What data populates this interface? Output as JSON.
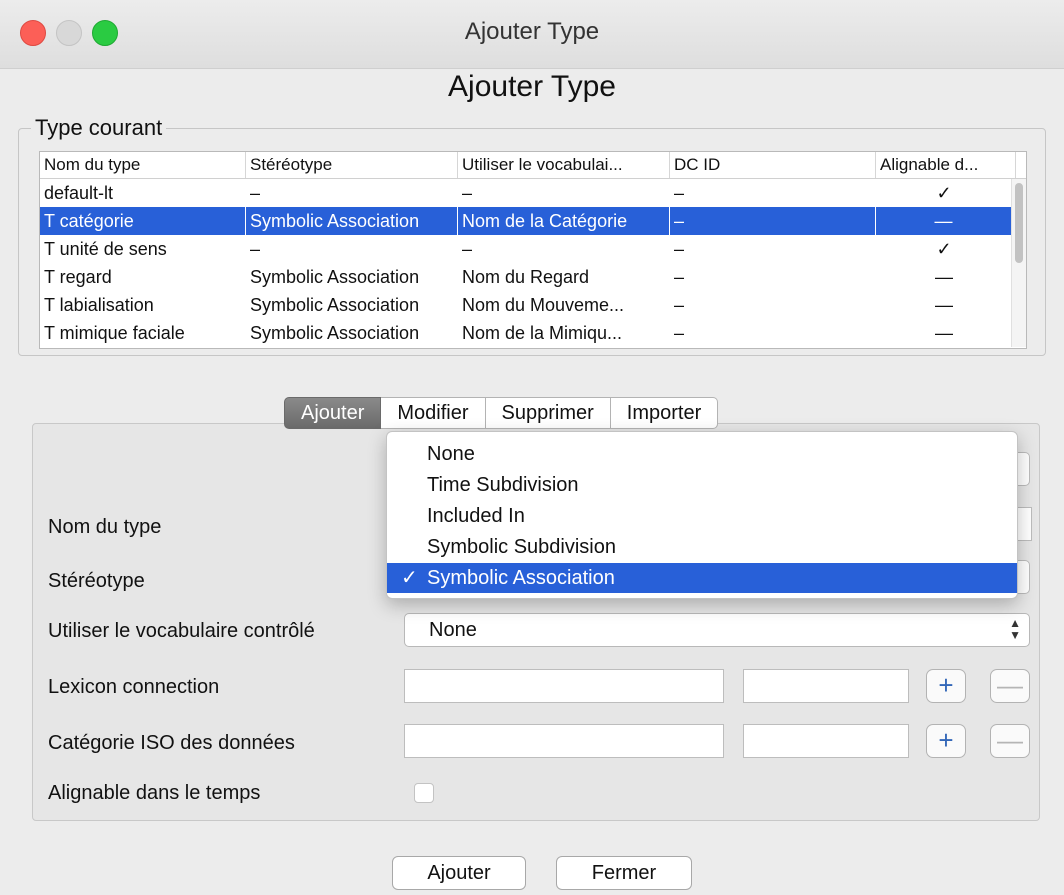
{
  "window": {
    "title": "Ajouter Type"
  },
  "dialog": {
    "heading": "Ajouter Type"
  },
  "current_types": {
    "legend": "Type courant",
    "columns": [
      "Nom du type",
      "Stéréotype",
      "Utiliser le vocabulai...",
      "DC ID",
      "Alignable d..."
    ],
    "rows": [
      {
        "name": "default-lt",
        "stereotype": "–",
        "vocab": "–",
        "dcid": "–",
        "alignable": "✓"
      },
      {
        "name": "T catégorie",
        "stereotype": "Symbolic Association",
        "vocab": "Nom de la Catégorie",
        "dcid": "–",
        "alignable": "—"
      },
      {
        "name": "T unité de sens",
        "stereotype": "–",
        "vocab": "–",
        "dcid": "–",
        "alignable": "✓"
      },
      {
        "name": "T regard",
        "stereotype": "Symbolic Association",
        "vocab": "Nom du Regard",
        "dcid": "–",
        "alignable": "—"
      },
      {
        "name": "T labialisation",
        "stereotype": "Symbolic Association",
        "vocab": "Nom du Mouveme...",
        "dcid": "–",
        "alignable": "—"
      },
      {
        "name": "T mimique faciale",
        "stereotype": "Symbolic Association",
        "vocab": "Nom de la Mimiqu...",
        "dcid": "–",
        "alignable": "—"
      }
    ],
    "selected_row": 1
  },
  "tabs": [
    "Ajouter",
    "Modifier",
    "Supprimer",
    "Importer"
  ],
  "active_tab": "Ajouter",
  "form": {
    "name_label": "Nom du type",
    "stereotype_label": "Stéréotype",
    "vocab_label": "Utiliser le vocabulaire contrôlé",
    "vocab_value": "None",
    "lexicon_label": "Lexicon connection",
    "iso_label": "Catégorie ISO des données",
    "alignable_label": "Alignable dans le temps",
    "alignable_checked": false,
    "plus_symbol": "+",
    "minus_symbol": "—"
  },
  "stereotype_dropdown": {
    "options": [
      "None",
      "Time Subdivision",
      "Included In",
      "Symbolic Subdivision",
      "Symbolic Association"
    ],
    "selected": "Symbolic Association",
    "check": "✓"
  },
  "buttons": {
    "add": "Ajouter",
    "close": "Fermer"
  },
  "colors": {
    "selection": "#2860d8",
    "plus": "#3367b8"
  }
}
